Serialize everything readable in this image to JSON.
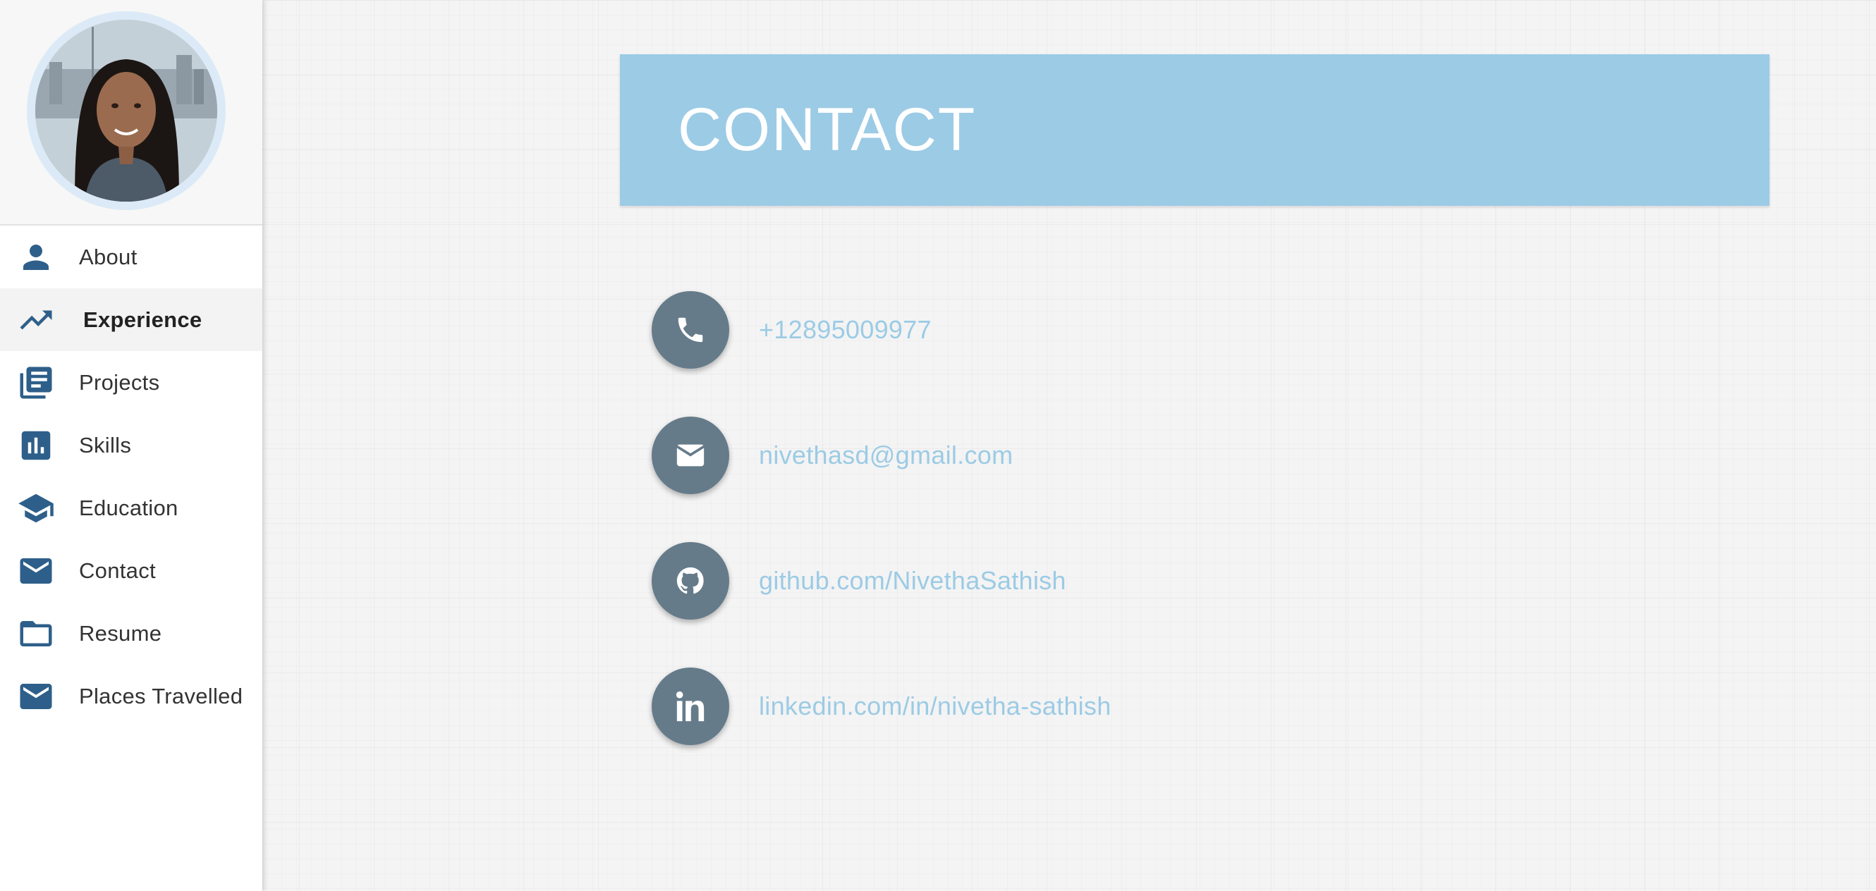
{
  "sidebar": {
    "profile": {
      "icon": "avatar-photo"
    },
    "items": [
      {
        "label": "About",
        "icon": "person-icon"
      },
      {
        "label": "Experience",
        "icon": "trending-up-icon",
        "active": true
      },
      {
        "label": "Projects",
        "icon": "library-books-icon"
      },
      {
        "label": "Skills",
        "icon": "bar-chart-icon"
      },
      {
        "label": "Education",
        "icon": "graduation-cap-icon"
      },
      {
        "label": "Contact",
        "icon": "mail-icon"
      },
      {
        "label": "Resume",
        "icon": "folder-icon"
      },
      {
        "label": "Places Travelled",
        "icon": "mail-icon"
      }
    ]
  },
  "main": {
    "title": "CONTACT",
    "contacts": [
      {
        "text": "+12895009977",
        "icon": "phone-icon"
      },
      {
        "text": "nivethasd@gmail.com",
        "icon": "envelope-icon"
      },
      {
        "text": "github.com/NivethaSathish",
        "icon": "github-icon"
      },
      {
        "text": "linkedin.com/in/nivetha-sathish",
        "icon": "linkedin-icon"
      }
    ]
  },
  "colors": {
    "banner": "#9ccbe5",
    "nav_icon": "#2e5f8a",
    "contact_circle": "#657b8a",
    "link": "#9ccbe5"
  }
}
